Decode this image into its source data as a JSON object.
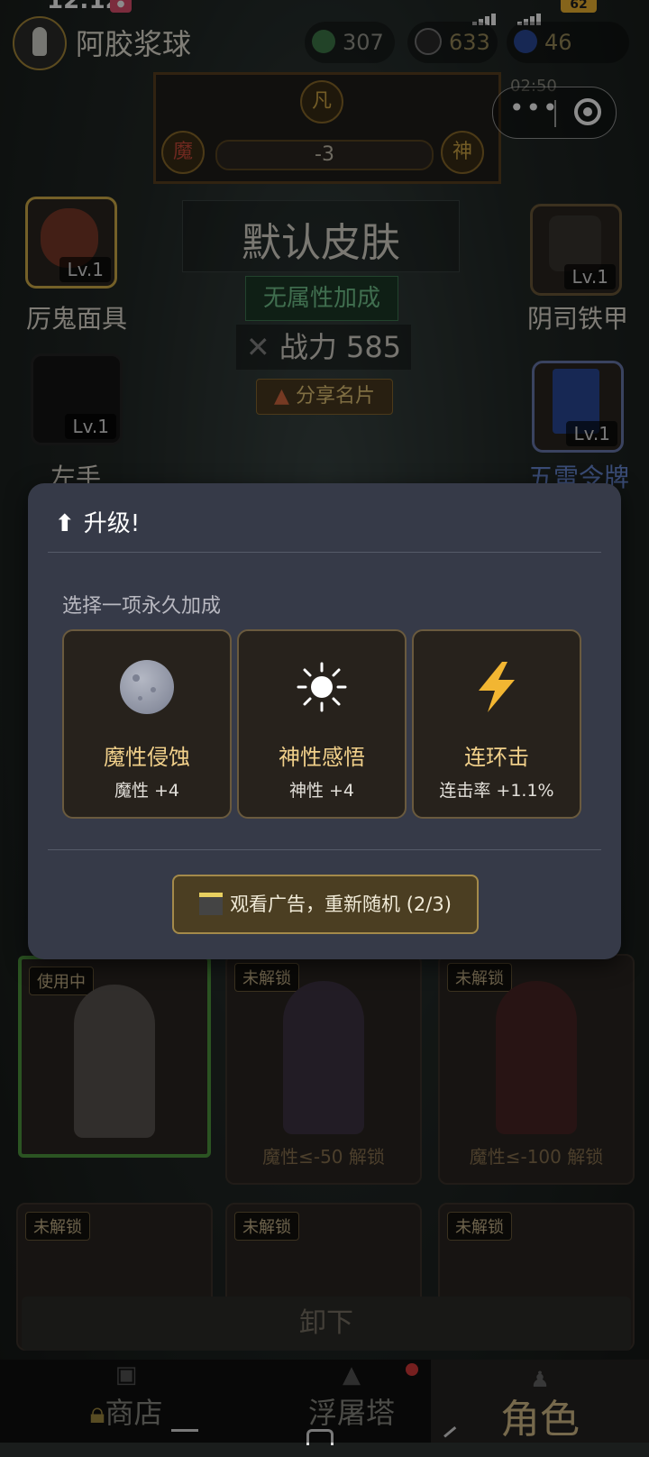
{
  "status": {
    "time": "12:12",
    "battery": "62"
  },
  "header": {
    "username": "阿胶浆球"
  },
  "resources": [
    {
      "icon": "jade-icon",
      "value": "307"
    },
    {
      "icon": "coin-icon",
      "value": "633"
    },
    {
      "icon": "energy-icon",
      "value": "46",
      "timer": "02:50"
    }
  ],
  "karma": {
    "top_seal": "凡",
    "left_seal": "魔",
    "right_seal": "神",
    "value": "-3"
  },
  "equipment": {
    "level": "Lv.1",
    "slots": [
      {
        "label": "厉鬼面具"
      },
      {
        "label": "阴司铁甲"
      },
      {
        "label": "左手"
      },
      {
        "label": "五雷令牌"
      }
    ]
  },
  "skin": {
    "title": "默认皮肤",
    "attribute": "无属性加成",
    "power": "战力 585",
    "share_label": "分享名片"
  },
  "skin_grid": {
    "using_tag": "使用中",
    "locked_tag": "未解锁",
    "unlock_1": "魔性≤-50 解锁",
    "unlock_2": "魔性≤-100 解锁"
  },
  "uninstall_label": "卸下",
  "nav": {
    "shop": "商店",
    "tower": "浮屠塔",
    "character": "角色"
  },
  "modal": {
    "title": "升级!",
    "subtitle": "选择一项永久加成",
    "options": [
      {
        "icon": "moon-icon",
        "name": "魔性侵蚀",
        "value": "魔性 +4"
      },
      {
        "icon": "sun-icon",
        "name": "神性感悟",
        "value": "神性 +4"
      },
      {
        "icon": "lightning-icon",
        "name": "连环击",
        "value": "连击率 +1.1%"
      }
    ],
    "ad_button": "观看广告，重新随机 (2/3)"
  }
}
